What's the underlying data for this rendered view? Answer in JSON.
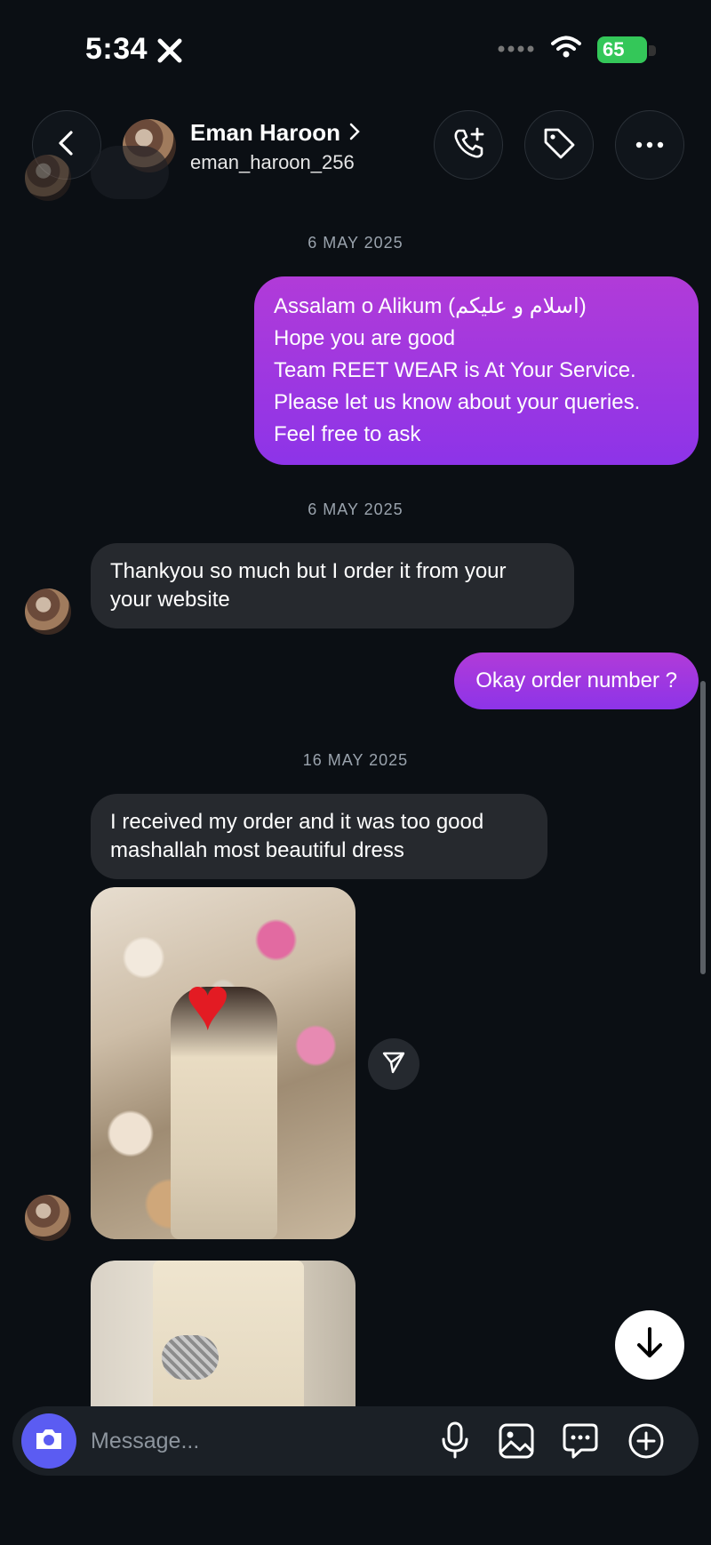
{
  "status_bar": {
    "time": "5:34",
    "battery": "65"
  },
  "header": {
    "name": "Eman Haroon",
    "username": "eman_haroon_256",
    "buttons": {
      "back": "back-icon",
      "call": "phone-add-icon",
      "tag": "tag-icon",
      "more": "more-horizontal-icon"
    }
  },
  "conversation": {
    "dates": [
      "6 MAY 2025",
      "6 MAY 2025",
      "16 MAY 2025"
    ],
    "messages": [
      {
        "direction": "outgoing",
        "lines": [
          "Assalam o Alikum (اسلام و علیکم)",
          "Hope you are good",
          "Team REET WEAR  is At Your Service.",
          "Please let us know about your queries.",
          "Feel free to ask"
        ]
      },
      {
        "direction": "incoming",
        "lines": [
          "Thankyou so much but I order it from your",
          "your website"
        ]
      },
      {
        "direction": "outgoing",
        "lines": [
          "Okay order number ?"
        ]
      },
      {
        "direction": "incoming",
        "lines": [
          "I received my order and it was too good",
          "mashallah most beautiful dress"
        ]
      }
    ]
  },
  "composer": {
    "placeholder": "Message..."
  },
  "colors": {
    "background": "#0b0f14",
    "outgoing_bubble": "#a03ae0",
    "incoming_bubble": "#26292e",
    "camera_button": "#5b5cf2",
    "battery": "#34c759"
  }
}
